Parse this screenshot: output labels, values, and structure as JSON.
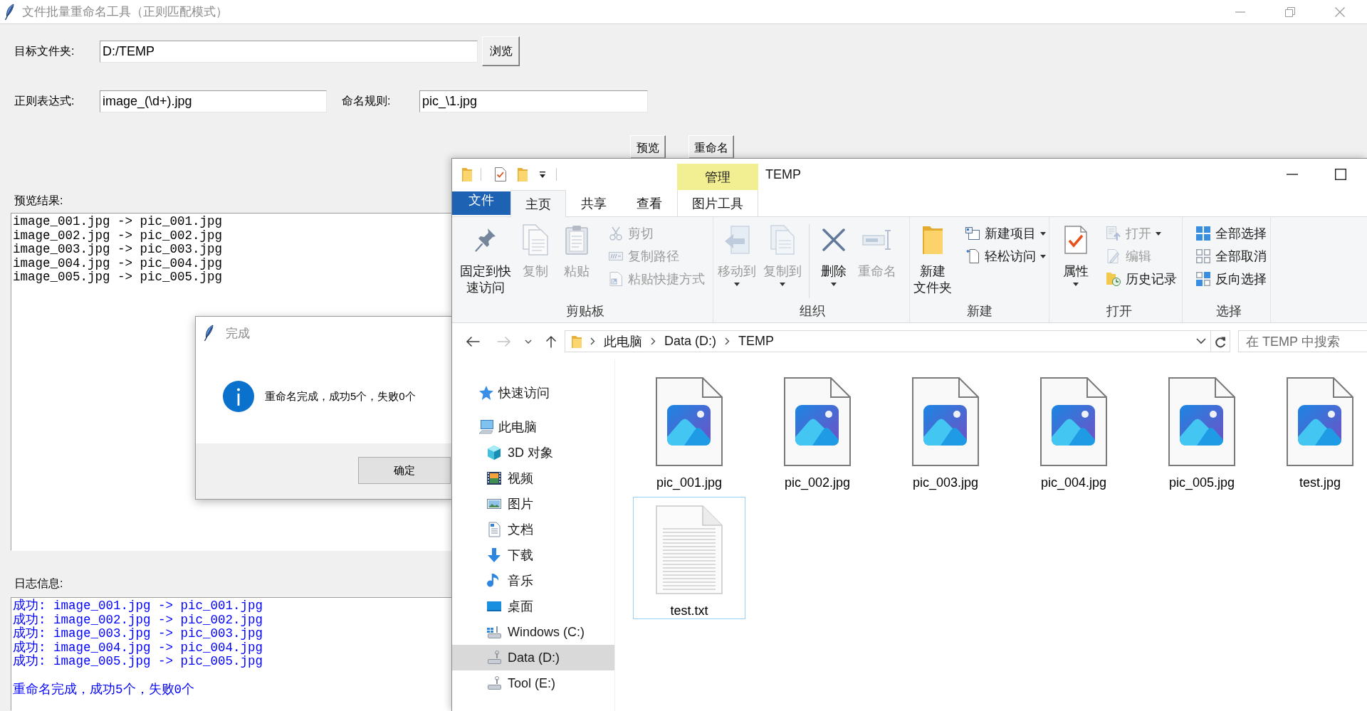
{
  "app": {
    "title": "文件批量重命名工具（正则匹配模式）",
    "folder": {
      "label": "目标文件夹:",
      "value": "D:/TEMP",
      "button": "浏览"
    },
    "pattern": {
      "label": "正则表达式:",
      "value": "image_(\\d+).jpg"
    },
    "rule": {
      "label": "命名规则:",
      "value": "pic_\\1.jpg"
    },
    "actions": [
      "预览",
      "重命名"
    ],
    "preview": {
      "label": "预览结果:",
      "lines": [
        "image_001.jpg -> pic_001.jpg",
        "image_002.jpg -> pic_002.jpg",
        "image_003.jpg -> pic_003.jpg",
        "image_004.jpg -> pic_004.jpg",
        "image_005.jpg -> pic_005.jpg"
      ]
    },
    "log": {
      "label": "日志信息:",
      "lines": [
        "成功: image_001.jpg -> pic_001.jpg",
        "成功: image_002.jpg -> pic_002.jpg",
        "成功: image_003.jpg -> pic_003.jpg",
        "成功: image_004.jpg -> pic_004.jpg",
        "成功: image_005.jpg -> pic_005.jpg"
      ],
      "summary": "重命名完成，成功5个，失败0个"
    }
  },
  "dialog": {
    "title": "完成",
    "message": "重命名完成，成功5个，失败0个",
    "button": "确定"
  },
  "explorer": {
    "title": "TEMP",
    "context_header": "管理",
    "tabs": [
      {
        "label": "文件",
        "kind": "file",
        "selected": false
      },
      {
        "label": "主页",
        "kind": "normal",
        "selected": true
      },
      {
        "label": "共享",
        "kind": "normal",
        "selected": false
      },
      {
        "label": "查看",
        "kind": "normal",
        "selected": false
      },
      {
        "label": "图片工具",
        "kind": "contextual",
        "selected": false
      }
    ],
    "ribbon": {
      "groups": [
        {
          "label": "剪贴板",
          "sections": [
            [
              {
                "lines": [
                  "固定到快",
                  "速访问"
                ],
                "kind": "large",
                "disabled": false,
                "dropdown": false
              },
              {
                "lines": [
                  "复制"
                ],
                "kind": "large",
                "disabled": true,
                "dropdown": false
              },
              {
                "lines": [
                  "粘贴"
                ],
                "kind": "large",
                "disabled": true,
                "dropdown": false
              },
              {
                "label": "剪切",
                "kind": "small",
                "disabled": true,
                "dropdown": false
              },
              {
                "label": "复制路径",
                "kind": "small",
                "disabled": true,
                "dropdown": false
              },
              {
                "label": "粘贴快捷方式",
                "kind": "small",
                "disabled": true,
                "dropdown": false
              }
            ]
          ]
        },
        {
          "label": "组织",
          "sections": [
            [
              {
                "lines": [
                  "移动到"
                ],
                "kind": "large",
                "disabled": true,
                "dropdown": true
              },
              {
                "lines": [
                  "复制到"
                ],
                "kind": "large",
                "disabled": true,
                "dropdown": true
              }
            ],
            [
              {
                "lines": [
                  "删除"
                ],
                "kind": "large",
                "disabled": false,
                "dropdown": true
              },
              {
                "lines": [
                  "重命名"
                ],
                "kind": "large",
                "disabled": true,
                "dropdown": false
              }
            ]
          ]
        },
        {
          "label": "新建",
          "sections": [
            [
              {
                "lines": [
                  "新建",
                  "文件夹"
                ],
                "kind": "large",
                "disabled": false,
                "dropdown": false
              },
              {
                "label": "新建项目",
                "kind": "small",
                "disabled": false,
                "dropdown": true
              },
              {
                "label": "轻松访问",
                "kind": "small",
                "disabled": false,
                "dropdown": true
              }
            ]
          ]
        },
        {
          "label": "打开",
          "sections": [
            [
              {
                "lines": [
                  "属性"
                ],
                "kind": "large",
                "disabled": false,
                "dropdown": true
              },
              {
                "label": "打开",
                "kind": "small",
                "disabled": true,
                "dropdown": true
              },
              {
                "label": "编辑",
                "kind": "small",
                "disabled": true,
                "dropdown": false
              },
              {
                "label": "历史记录",
                "kind": "small",
                "disabled": false,
                "dropdown": false
              }
            ]
          ]
        },
        {
          "label": "选择",
          "sections": [
            [
              {
                "label": "全部选择",
                "kind": "small",
                "disabled": false,
                "dropdown": false
              },
              {
                "label": "全部取消",
                "kind": "small",
                "disabled": false,
                "dropdown": false
              },
              {
                "label": "反向选择",
                "kind": "small",
                "disabled": false,
                "dropdown": false
              }
            ]
          ]
        }
      ]
    },
    "back": {
      "disabled": false
    },
    "forward": {
      "disabled": true
    },
    "address": [
      "此电脑",
      "Data (D:)",
      "TEMP"
    ],
    "search": {
      "placeholder": "在 TEMP 中搜索"
    },
    "nav": [
      {
        "label": "快速访问",
        "selected": false
      },
      {
        "label": "此电脑",
        "selected": false,
        "children": [
          {
            "label": "3D 对象",
            "selected": false
          },
          {
            "label": "视频",
            "selected": false
          },
          {
            "label": "图片",
            "selected": false
          },
          {
            "label": "文档",
            "selected": false
          },
          {
            "label": "下载",
            "selected": false
          },
          {
            "label": "音乐",
            "selected": false
          },
          {
            "label": "桌面",
            "selected": false
          },
          {
            "label": "Windows (C:)",
            "selected": false
          },
          {
            "label": "Data (D:)",
            "selected": true
          },
          {
            "label": "Tool (E:)",
            "selected": false
          }
        ]
      }
    ],
    "files": [
      {
        "name": "pic_001.jpg",
        "kind": "image",
        "focused": false
      },
      {
        "name": "pic_002.jpg",
        "kind": "image",
        "focused": false
      },
      {
        "name": "pic_003.jpg",
        "kind": "image",
        "focused": false
      },
      {
        "name": "pic_004.jpg",
        "kind": "image",
        "focused": false
      },
      {
        "name": "pic_005.jpg",
        "kind": "image",
        "focused": false
      },
      {
        "name": "test.jpg",
        "kind": "image",
        "focused": false
      },
      {
        "name": "test.txt",
        "kind": "text",
        "focused": true
      }
    ]
  }
}
